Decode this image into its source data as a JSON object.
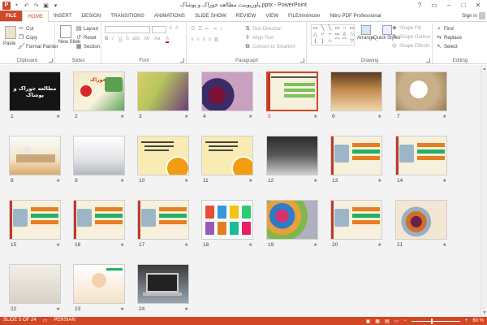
{
  "titlebar": {
    "app_icon": "P",
    "title": "پاورپوینت مطالعه خوراک و پوشاک.pptx - PowerPoint",
    "qat_icons": [
      "save-icon",
      "undo-icon",
      "redo-icon",
      "start-from-beginning-icon"
    ],
    "window_controls": [
      "?",
      "▭",
      "–",
      "□",
      "✕"
    ]
  },
  "tabs": {
    "items": [
      "FILE",
      "HOME",
      "INSERT",
      "DESIGN",
      "TRANSITIONS",
      "ANIMATIONS",
      "SLIDE SHOW",
      "REVIEW",
      "VIEW",
      "FILEminimizer",
      "Nitro PDF Professional"
    ],
    "active": "HOME",
    "signin": "Sign in"
  },
  "ribbon": {
    "clipboard": {
      "label": "Clipboard",
      "paste": "Paste",
      "cut": "Cut",
      "copy": "Copy",
      "format_painter": "Format Painter"
    },
    "slides": {
      "label": "Slides",
      "new_slide": "New Slide",
      "layout": "Layout",
      "reset": "Reset",
      "section": "Section"
    },
    "font": {
      "label": "Font",
      "buttons": [
        "B",
        "I",
        "U",
        "S",
        "abc",
        "AV",
        "Aa",
        "A"
      ]
    },
    "paragraph": {
      "label": "Paragraph",
      "text_direction": "Text Direction",
      "align_text": "Align Text",
      "convert_smartart": "Convert to SmartArt"
    },
    "drawing": {
      "label": "Drawing",
      "arrange": "Arrange",
      "quick_styles": "Quick Styles",
      "shape_fill": "Shape Fill",
      "shape_outline": "Shape Outline",
      "shape_effects": "Shape Effects",
      "shapes": [
        "▭",
        "╲",
        "╲",
        "▭",
        "○",
        "▭",
        "△",
        "⌐",
        "⌐",
        "⇨",
        "⇩",
        "☆",
        "{",
        "}",
        "☆",
        "⌒",
        "⌒",
        "▽"
      ]
    },
    "editing": {
      "label": "Editing",
      "find": "Find",
      "replace": "Replace",
      "select": "Select"
    }
  },
  "slides": [
    {
      "num": "1",
      "title": "مطالعه خوراک و پوشاک"
    },
    {
      "num": "2",
      "title": "خوراک"
    },
    {
      "num": "3",
      "title": ""
    },
    {
      "num": "4",
      "title": ""
    },
    {
      "num": "5",
      "title": ""
    },
    {
      "num": "6",
      "title": ""
    },
    {
      "num": "7",
      "title": ""
    },
    {
      "num": "8",
      "title": ""
    },
    {
      "num": "9",
      "title": ""
    },
    {
      "num": "10",
      "title": ""
    },
    {
      "num": "11",
      "title": ""
    },
    {
      "num": "12",
      "title": ""
    },
    {
      "num": "13",
      "title": ""
    },
    {
      "num": "14",
      "title": ""
    },
    {
      "num": "15",
      "title": ""
    },
    {
      "num": "16",
      "title": ""
    },
    {
      "num": "17",
      "title": ""
    },
    {
      "num": "18",
      "title": ""
    },
    {
      "num": "19",
      "title": ""
    },
    {
      "num": "20",
      "title": ""
    },
    {
      "num": "21",
      "title": ""
    },
    {
      "num": "22",
      "title": ""
    },
    {
      "num": "23",
      "title": ""
    },
    {
      "num": "24",
      "title": ""
    }
  ],
  "selected_slide": "5",
  "star_glyph": "★",
  "status": {
    "slide_info": "SLIDE 5 OF 24",
    "language": "PERSIAN",
    "zoom": "60 %",
    "zoom_minus": "−",
    "zoom_plus": "+"
  }
}
